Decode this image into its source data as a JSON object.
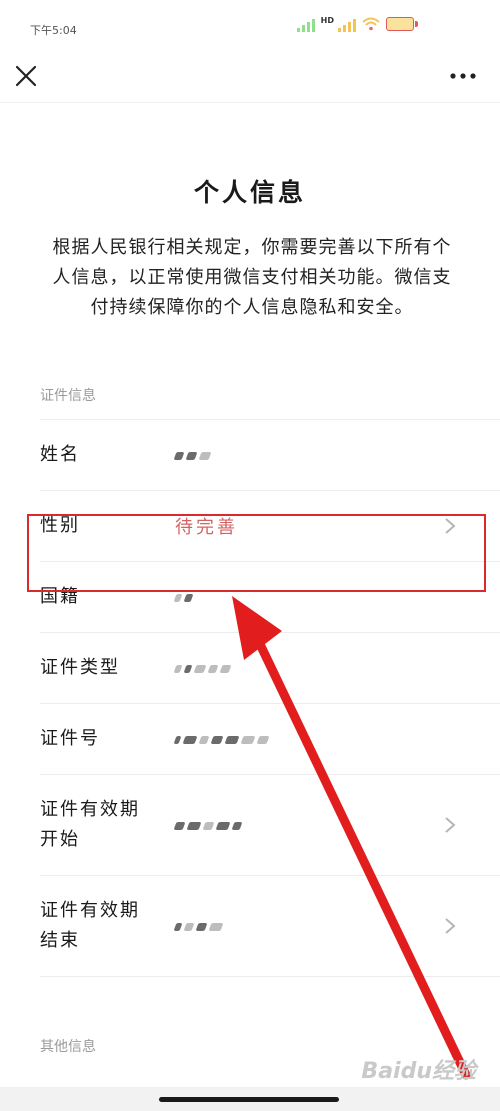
{
  "status_bar": {
    "time": "下午5:04",
    "network_label": "HD",
    "battery_level": "1/4"
  },
  "nav": {
    "close_icon": "close-icon",
    "more_icon": "more-icon"
  },
  "page": {
    "title": "个人信息",
    "description": "根据人民银行相关规定，你需要完善以下所有个人信息，以正常使用微信支付相关功能。微信支付持续保障你的个人信息隐私和安全。"
  },
  "sections": {
    "id_info_label": "证件信息",
    "other_info_label": "其他信息"
  },
  "fields": [
    {
      "label": "姓名",
      "value_state": "masked"
    },
    {
      "label": "性别",
      "value": "待完善",
      "value_state": "pending"
    },
    {
      "label": "国籍",
      "value_state": "masked"
    },
    {
      "label": "证件类型",
      "value_state": "masked"
    },
    {
      "label": "证件号",
      "value_state": "masked"
    },
    {
      "label_line1": "证件有效期",
      "label_line2": "开始",
      "value_state": "masked"
    },
    {
      "label_line1": "证件有效期",
      "label_line2": "结束",
      "value_state": "masked"
    }
  ],
  "overlay": {
    "highlight_color": "#d92b2b",
    "arrow_color": "#e21d1d"
  },
  "watermark": "Baidu经验",
  "colors": {
    "pending_text": "#d46464",
    "section_label": "#9b9b9b"
  }
}
